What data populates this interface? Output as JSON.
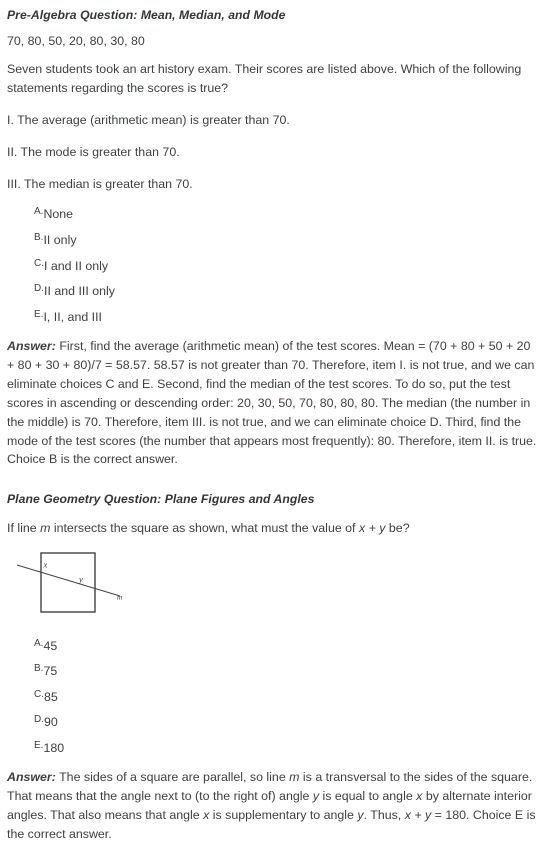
{
  "document": {
    "sections": [
      {
        "id": "pre-algebra",
        "heading": "Pre-Algebra Question: Mean, Median, and Mode",
        "scores": "70, 80, 50, 20, 80, 30, 80",
        "stem": "Seven students took an art history exam. Their scores are listed above. Which of the following statements regarding the scores is true?",
        "roman_items": [
          "I. The average (arithmetic mean) is greater than 70.",
          "II. The mode is greater than 70.",
          "III. The median is greater than 70."
        ],
        "choices": [
          {
            "letter": "A.",
            "text": "None"
          },
          {
            "letter": "B.",
            "text": "II only"
          },
          {
            "letter": "C.",
            "text": "I and II only"
          },
          {
            "letter": "D.",
            "text": "II and III only"
          },
          {
            "letter": "E.",
            "text": "I, II, and III"
          }
        ],
        "answer_label": "Answer:",
        "answer_text": " First, find the average (arithmetic mean) of the test scores. Mean = (70 + 80 + 50 + 20 + 80 + 30 + 80)/7 = 58.57. 58.57 is not greater than 70. Therefore, item I. is not true, and we can eliminate choices C and E. Second, find the median of the test scores. To do so, put the test scores in ascending or descending order: 20, 30, 50, 70, 80, 80, 80. The median (the number in the middle) is 70. Therefore, item III. is not true, and we can eliminate choice D. Third, find the mode of the test scores (the number that appears most frequently): 80. Therefore, item II. is true. Choice B is the correct answer."
      },
      {
        "id": "plane-geometry",
        "heading": "Plane Geometry Question: Plane Figures and Angles",
        "stem_prefix": "If line ",
        "stem_var": "m",
        "stem_suffix": " intersects the square as shown, what must the value of ",
        "stem_expr": "x + y",
        "stem_end": " be?",
        "figure": {
          "name": "square-with-transversal",
          "labels": {
            "angle_x": "x",
            "angle_y": "y",
            "line_m": "m"
          },
          "stroke_color": "#333333"
        },
        "choices": [
          {
            "letter": "A.",
            "text": "45"
          },
          {
            "letter": "B.",
            "text": "75"
          },
          {
            "letter": "C.",
            "text": "85"
          },
          {
            "letter": "D.",
            "text": "90"
          },
          {
            "letter": "E.",
            "text": "180"
          }
        ],
        "answer_label": "Answer:",
        "answer_parts": {
          "p1": " The sides of a square are parallel, so line ",
          "v1": "m",
          "p2": " is a transversal to the sides of the square. That means that the angle next to (to the right of) angle ",
          "v2": "y",
          "p3": " is equal to angle ",
          "v3": "x",
          "p4": " by alternate interior angles. That also means that angle ",
          "v4": "x",
          "p5": " is supplementary to angle ",
          "v5": "y",
          "p6": ". Thus, ",
          "v6": "x + y",
          "p7": " = 180. Choice E is the correct answer."
        }
      }
    ]
  }
}
